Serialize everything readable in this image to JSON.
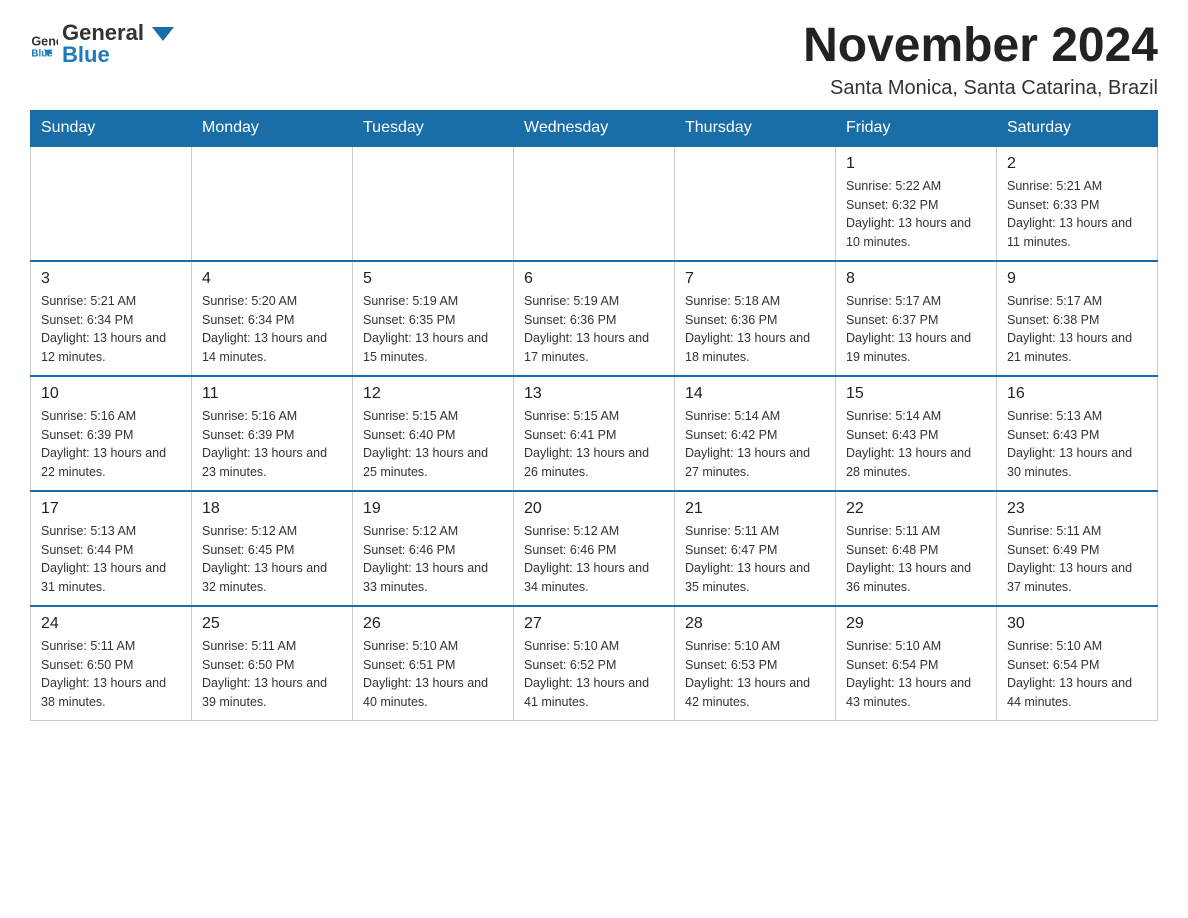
{
  "logo": {
    "text_general": "General",
    "text_blue": "Blue"
  },
  "header": {
    "month_title": "November 2024",
    "location": "Santa Monica, Santa Catarina, Brazil"
  },
  "days_of_week": [
    "Sunday",
    "Monday",
    "Tuesday",
    "Wednesday",
    "Thursday",
    "Friday",
    "Saturday"
  ],
  "weeks": [
    [
      {
        "day": "",
        "sunrise": "",
        "sunset": "",
        "daylight": ""
      },
      {
        "day": "",
        "sunrise": "",
        "sunset": "",
        "daylight": ""
      },
      {
        "day": "",
        "sunrise": "",
        "sunset": "",
        "daylight": ""
      },
      {
        "day": "",
        "sunrise": "",
        "sunset": "",
        "daylight": ""
      },
      {
        "day": "",
        "sunrise": "",
        "sunset": "",
        "daylight": ""
      },
      {
        "day": "1",
        "sunrise": "Sunrise: 5:22 AM",
        "sunset": "Sunset: 6:32 PM",
        "daylight": "Daylight: 13 hours and 10 minutes."
      },
      {
        "day": "2",
        "sunrise": "Sunrise: 5:21 AM",
        "sunset": "Sunset: 6:33 PM",
        "daylight": "Daylight: 13 hours and 11 minutes."
      }
    ],
    [
      {
        "day": "3",
        "sunrise": "Sunrise: 5:21 AM",
        "sunset": "Sunset: 6:34 PM",
        "daylight": "Daylight: 13 hours and 12 minutes."
      },
      {
        "day": "4",
        "sunrise": "Sunrise: 5:20 AM",
        "sunset": "Sunset: 6:34 PM",
        "daylight": "Daylight: 13 hours and 14 minutes."
      },
      {
        "day": "5",
        "sunrise": "Sunrise: 5:19 AM",
        "sunset": "Sunset: 6:35 PM",
        "daylight": "Daylight: 13 hours and 15 minutes."
      },
      {
        "day": "6",
        "sunrise": "Sunrise: 5:19 AM",
        "sunset": "Sunset: 6:36 PM",
        "daylight": "Daylight: 13 hours and 17 minutes."
      },
      {
        "day": "7",
        "sunrise": "Sunrise: 5:18 AM",
        "sunset": "Sunset: 6:36 PM",
        "daylight": "Daylight: 13 hours and 18 minutes."
      },
      {
        "day": "8",
        "sunrise": "Sunrise: 5:17 AM",
        "sunset": "Sunset: 6:37 PM",
        "daylight": "Daylight: 13 hours and 19 minutes."
      },
      {
        "day": "9",
        "sunrise": "Sunrise: 5:17 AM",
        "sunset": "Sunset: 6:38 PM",
        "daylight": "Daylight: 13 hours and 21 minutes."
      }
    ],
    [
      {
        "day": "10",
        "sunrise": "Sunrise: 5:16 AM",
        "sunset": "Sunset: 6:39 PM",
        "daylight": "Daylight: 13 hours and 22 minutes."
      },
      {
        "day": "11",
        "sunrise": "Sunrise: 5:16 AM",
        "sunset": "Sunset: 6:39 PM",
        "daylight": "Daylight: 13 hours and 23 minutes."
      },
      {
        "day": "12",
        "sunrise": "Sunrise: 5:15 AM",
        "sunset": "Sunset: 6:40 PM",
        "daylight": "Daylight: 13 hours and 25 minutes."
      },
      {
        "day": "13",
        "sunrise": "Sunrise: 5:15 AM",
        "sunset": "Sunset: 6:41 PM",
        "daylight": "Daylight: 13 hours and 26 minutes."
      },
      {
        "day": "14",
        "sunrise": "Sunrise: 5:14 AM",
        "sunset": "Sunset: 6:42 PM",
        "daylight": "Daylight: 13 hours and 27 minutes."
      },
      {
        "day": "15",
        "sunrise": "Sunrise: 5:14 AM",
        "sunset": "Sunset: 6:43 PM",
        "daylight": "Daylight: 13 hours and 28 minutes."
      },
      {
        "day": "16",
        "sunrise": "Sunrise: 5:13 AM",
        "sunset": "Sunset: 6:43 PM",
        "daylight": "Daylight: 13 hours and 30 minutes."
      }
    ],
    [
      {
        "day": "17",
        "sunrise": "Sunrise: 5:13 AM",
        "sunset": "Sunset: 6:44 PM",
        "daylight": "Daylight: 13 hours and 31 minutes."
      },
      {
        "day": "18",
        "sunrise": "Sunrise: 5:12 AM",
        "sunset": "Sunset: 6:45 PM",
        "daylight": "Daylight: 13 hours and 32 minutes."
      },
      {
        "day": "19",
        "sunrise": "Sunrise: 5:12 AM",
        "sunset": "Sunset: 6:46 PM",
        "daylight": "Daylight: 13 hours and 33 minutes."
      },
      {
        "day": "20",
        "sunrise": "Sunrise: 5:12 AM",
        "sunset": "Sunset: 6:46 PM",
        "daylight": "Daylight: 13 hours and 34 minutes."
      },
      {
        "day": "21",
        "sunrise": "Sunrise: 5:11 AM",
        "sunset": "Sunset: 6:47 PM",
        "daylight": "Daylight: 13 hours and 35 minutes."
      },
      {
        "day": "22",
        "sunrise": "Sunrise: 5:11 AM",
        "sunset": "Sunset: 6:48 PM",
        "daylight": "Daylight: 13 hours and 36 minutes."
      },
      {
        "day": "23",
        "sunrise": "Sunrise: 5:11 AM",
        "sunset": "Sunset: 6:49 PM",
        "daylight": "Daylight: 13 hours and 37 minutes."
      }
    ],
    [
      {
        "day": "24",
        "sunrise": "Sunrise: 5:11 AM",
        "sunset": "Sunset: 6:50 PM",
        "daylight": "Daylight: 13 hours and 38 minutes."
      },
      {
        "day": "25",
        "sunrise": "Sunrise: 5:11 AM",
        "sunset": "Sunset: 6:50 PM",
        "daylight": "Daylight: 13 hours and 39 minutes."
      },
      {
        "day": "26",
        "sunrise": "Sunrise: 5:10 AM",
        "sunset": "Sunset: 6:51 PM",
        "daylight": "Daylight: 13 hours and 40 minutes."
      },
      {
        "day": "27",
        "sunrise": "Sunrise: 5:10 AM",
        "sunset": "Sunset: 6:52 PM",
        "daylight": "Daylight: 13 hours and 41 minutes."
      },
      {
        "day": "28",
        "sunrise": "Sunrise: 5:10 AM",
        "sunset": "Sunset: 6:53 PM",
        "daylight": "Daylight: 13 hours and 42 minutes."
      },
      {
        "day": "29",
        "sunrise": "Sunrise: 5:10 AM",
        "sunset": "Sunset: 6:54 PM",
        "daylight": "Daylight: 13 hours and 43 minutes."
      },
      {
        "day": "30",
        "sunrise": "Sunrise: 5:10 AM",
        "sunset": "Sunset: 6:54 PM",
        "daylight": "Daylight: 13 hours and 44 minutes."
      }
    ]
  ]
}
